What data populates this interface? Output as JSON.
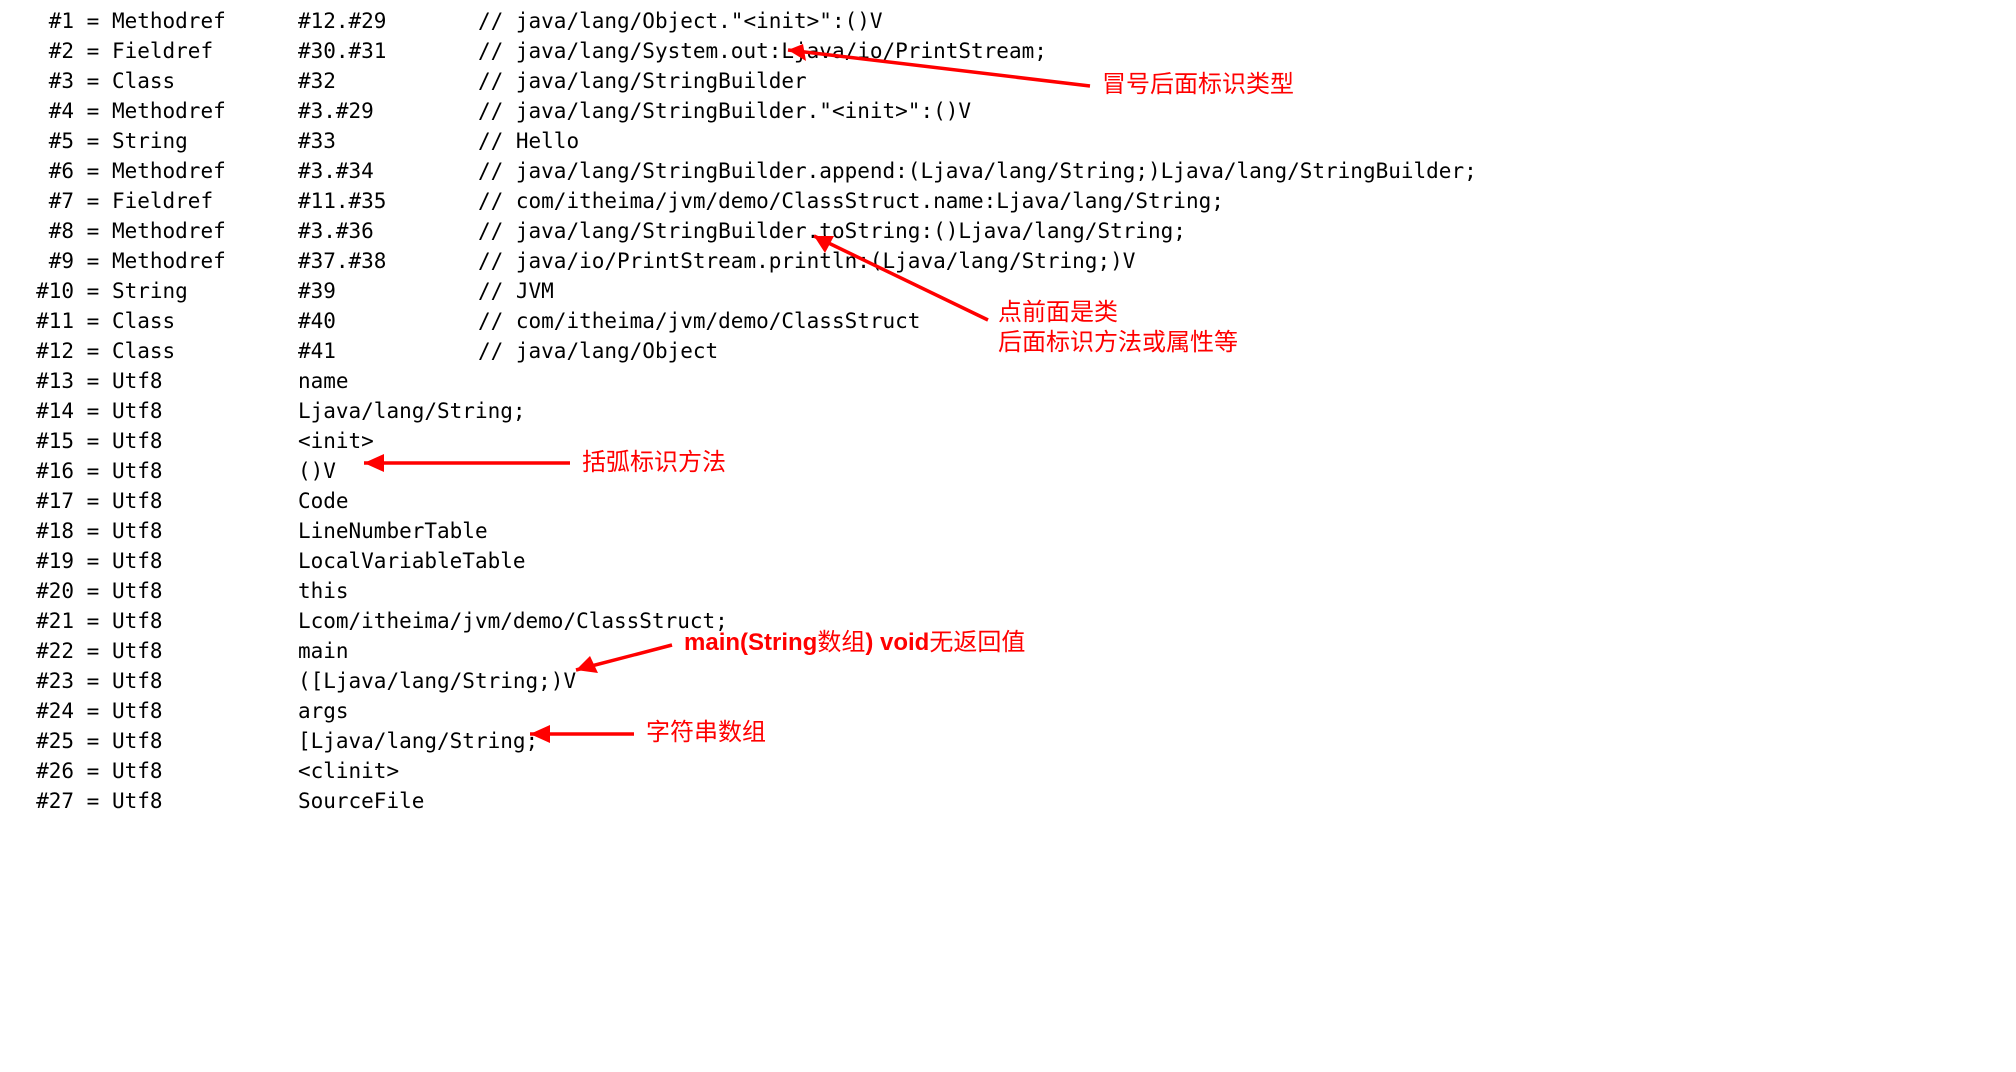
{
  "rows": [
    {
      "idx": "#1",
      "type": "Methodref",
      "val": "#12.#29",
      "cmt": "// java/lang/Object.\"<init>\":()V"
    },
    {
      "idx": "#2",
      "type": "Fieldref",
      "val": "#30.#31",
      "cmt": "// java/lang/System.out:Ljava/io/PrintStream;"
    },
    {
      "idx": "#3",
      "type": "Class",
      "val": "#32",
      "cmt": "// java/lang/StringBuilder"
    },
    {
      "idx": "#4",
      "type": "Methodref",
      "val": "#3.#29",
      "cmt": "// java/lang/StringBuilder.\"<init>\":()V"
    },
    {
      "idx": "#5",
      "type": "String",
      "val": "#33",
      "cmt": "// Hello"
    },
    {
      "idx": "#6",
      "type": "Methodref",
      "val": "#3.#34",
      "cmt": "// java/lang/StringBuilder.append:(Ljava/lang/String;)Ljava/lang/StringBuilder;"
    },
    {
      "idx": "#7",
      "type": "Fieldref",
      "val": "#11.#35",
      "cmt": "// com/itheima/jvm/demo/ClassStruct.name:Ljava/lang/String;"
    },
    {
      "idx": "#8",
      "type": "Methodref",
      "val": "#3.#36",
      "cmt": "// java/lang/StringBuilder.toString:()Ljava/lang/String;"
    },
    {
      "idx": "#9",
      "type": "Methodref",
      "val": "#37.#38",
      "cmt": "// java/io/PrintStream.println:(Ljava/lang/String;)V"
    },
    {
      "idx": "#10",
      "type": "String",
      "val": "#39",
      "cmt": "// JVM"
    },
    {
      "idx": "#11",
      "type": "Class",
      "val": "#40",
      "cmt": "// com/itheima/jvm/demo/ClassStruct"
    },
    {
      "idx": "#12",
      "type": "Class",
      "val": "#41",
      "cmt": "// java/lang/Object"
    },
    {
      "idx": "#13",
      "type": "Utf8",
      "val": "name",
      "cmt": ""
    },
    {
      "idx": "#14",
      "type": "Utf8",
      "val": "Ljava/lang/String;",
      "cmt": ""
    },
    {
      "idx": "#15",
      "type": "Utf8",
      "val": "<init>",
      "cmt": ""
    },
    {
      "idx": "#16",
      "type": "Utf8",
      "val": "()V",
      "cmt": ""
    },
    {
      "idx": "#17",
      "type": "Utf8",
      "val": "Code",
      "cmt": ""
    },
    {
      "idx": "#18",
      "type": "Utf8",
      "val": "LineNumberTable",
      "cmt": ""
    },
    {
      "idx": "#19",
      "type": "Utf8",
      "val": "LocalVariableTable",
      "cmt": ""
    },
    {
      "idx": "#20",
      "type": "Utf8",
      "val": "this",
      "cmt": ""
    },
    {
      "idx": "#21",
      "type": "Utf8",
      "val": "Lcom/itheima/jvm/demo/ClassStruct;",
      "cmt": ""
    },
    {
      "idx": "#22",
      "type": "Utf8",
      "val": "main",
      "cmt": ""
    },
    {
      "idx": "#23",
      "type": "Utf8",
      "val": "([Ljava/lang/String;)V",
      "cmt": ""
    },
    {
      "idx": "#24",
      "type": "Utf8",
      "val": "args",
      "cmt": ""
    },
    {
      "idx": "#25",
      "type": "Utf8",
      "val": "[Ljava/lang/String;",
      "cmt": ""
    },
    {
      "idx": "#26",
      "type": "Utf8",
      "val": "<clinit>",
      "cmt": ""
    },
    {
      "idx": "#27",
      "type": "Utf8",
      "val": "SourceFile",
      "cmt": ""
    }
  ],
  "notes": {
    "colon": "冒号后面标识类型",
    "dot1": "点前面是类",
    "dot2": "后面标识方法或属性等",
    "paren": "括弧标识方法",
    "main": "main(String数组) void无返回值",
    "arr": "字符串数组"
  }
}
